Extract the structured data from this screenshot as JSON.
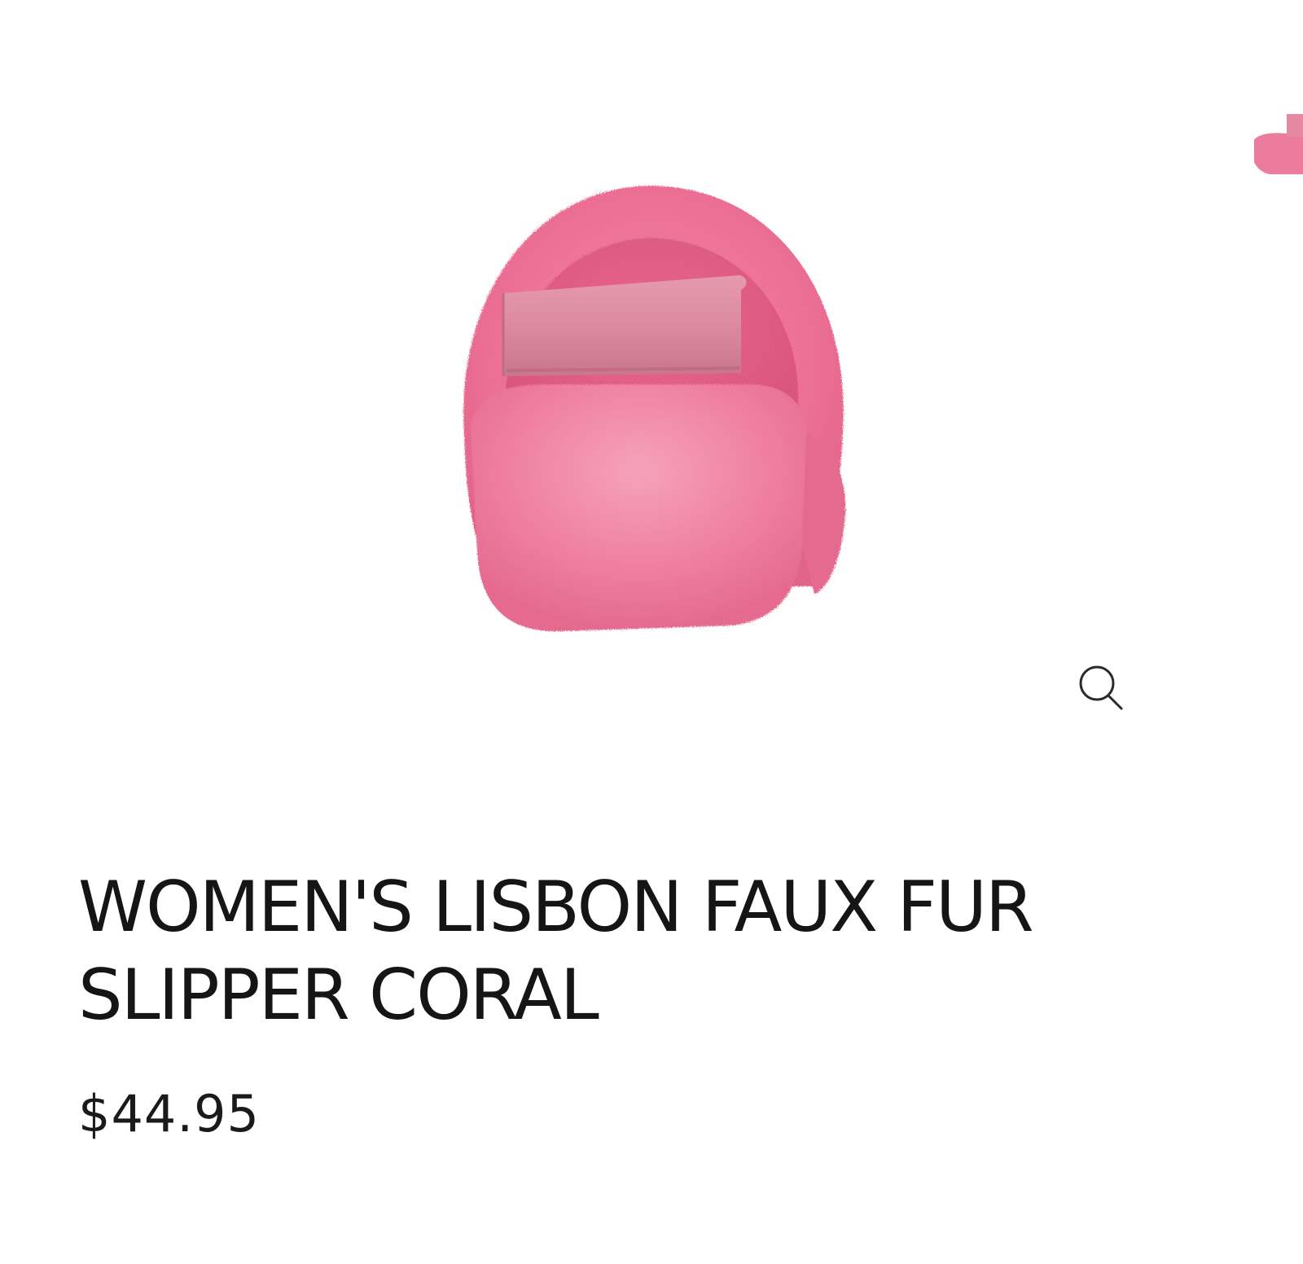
{
  "gallery": {
    "image_alt": "Pink faux fur slipper, rear view",
    "zoom_icon": "magnifier-icon",
    "colors": {
      "fur_main": "#ec6f95",
      "fur_light": "#f49ab6",
      "fur_shadow": "#d9557e",
      "strap": "#d9879a"
    }
  },
  "product": {
    "title": "WOMEN'S LISBON FAUX FUR SLIPPER CORAL",
    "price": "$44.95"
  }
}
